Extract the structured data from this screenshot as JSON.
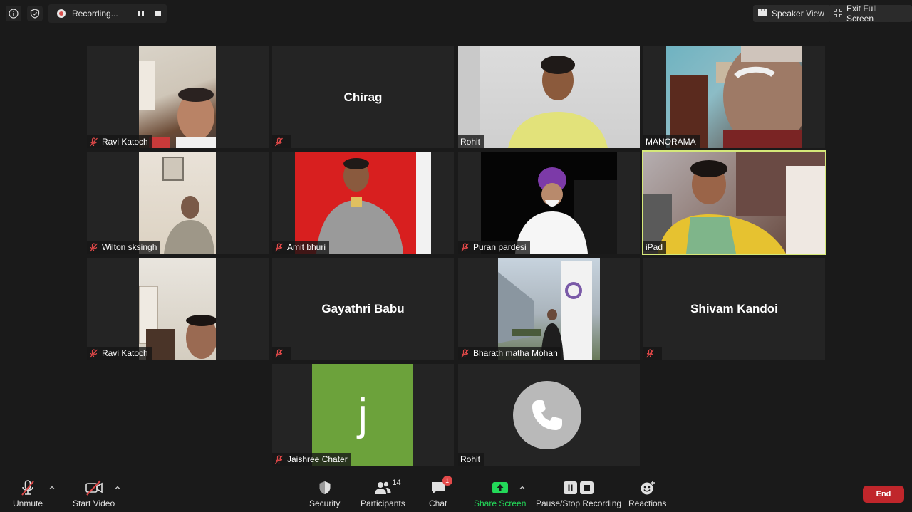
{
  "top_bar": {
    "recording_label": "Recording...",
    "speaker_view_label": "Speaker View",
    "exit_full_screen_label": "Exit Full Screen"
  },
  "participants": {
    "tile_1": {
      "name": "Ravi Katoch"
    },
    "tile_2": {
      "name": "Chirag"
    },
    "tile_3": {
      "name": "Rohit"
    },
    "tile_4": {
      "name": "MANORAMA"
    },
    "tile_5": {
      "name": "Wilton sksingh"
    },
    "tile_6": {
      "name": "Amit bhuri"
    },
    "tile_7": {
      "name": "Puran pardesi"
    },
    "tile_8": {
      "name": "iPad"
    },
    "tile_9": {
      "name": "Ravi Katoch"
    },
    "tile_10": {
      "name": "Gayathri Babu"
    },
    "tile_11": {
      "name": "Bharath matha Mohan"
    },
    "tile_12": {
      "name": "Shivam Kandoi"
    },
    "tile_13": {
      "name": "Jaishree Chater",
      "avatar_letter": "j",
      "avatar_color": "#6ca23b"
    },
    "tile_14": {
      "name": "Rohit"
    }
  },
  "active_speaker_color": "#d5e879",
  "toolbar": {
    "unmute": "Unmute",
    "start_video": "Start Video",
    "security": "Security",
    "participants": "Participants",
    "participants_count": "14",
    "chat": "Chat",
    "chat_badge": "1",
    "share_screen": "Share Screen",
    "pause_stop_recording": "Pause/Stop Recording",
    "reactions": "Reactions",
    "end": "End",
    "share_color": "#23d959",
    "end_color": "#c0262b"
  }
}
